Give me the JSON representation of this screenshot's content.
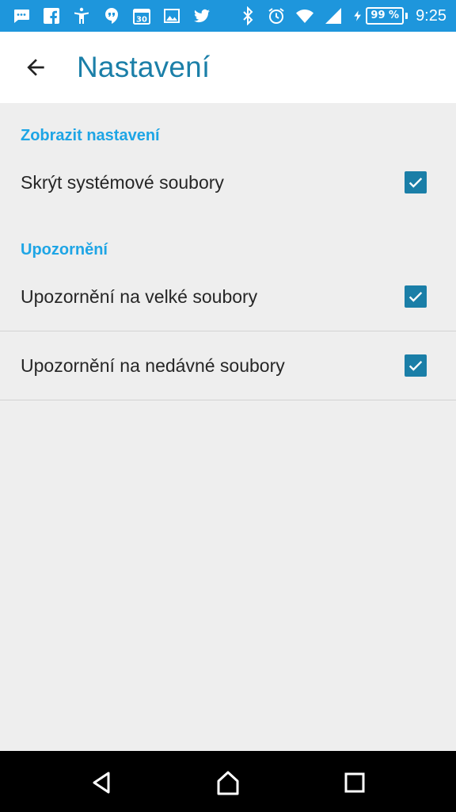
{
  "status_bar": {
    "left_icons": [
      "messages-icon",
      "facebook-icon",
      "accessibility-icon",
      "hangouts-icon",
      "calendar-icon",
      "gallery-icon",
      "twitter-icon"
    ],
    "calendar_day": "30",
    "battery_percent": "99 %",
    "time": "9:25"
  },
  "app_bar": {
    "title": "Nastavení"
  },
  "sections": [
    {
      "header": "Zobrazit nastavení",
      "items": [
        {
          "label": "Skrýt systémové soubory",
          "checked": true
        }
      ]
    },
    {
      "header": "Upozornění",
      "items": [
        {
          "label": "Upozornění na velké soubory",
          "checked": true
        },
        {
          "label": "Upozornění na nedávné soubory",
          "checked": true
        }
      ]
    }
  ],
  "colors": {
    "status_bar": "#1e96dc",
    "accent": "#1ea5e5",
    "title": "#1b7fa8",
    "checkbox": "#1a7ea7"
  }
}
